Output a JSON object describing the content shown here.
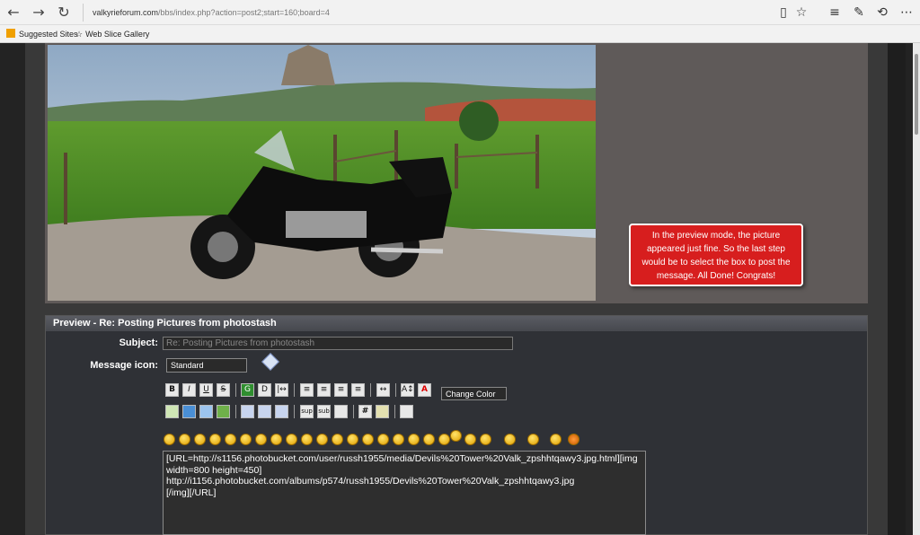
{
  "browser": {
    "url_domain": "valkyrieforum.com",
    "url_path": "/bbs/index.php?action=post2;start=160;board=4",
    "favorites": [
      {
        "label": "Suggested Sites"
      },
      {
        "label": "Web Slice Gallery"
      }
    ]
  },
  "post": {
    "callout_text": "In the preview mode, the picture appeared just fine. So the last step would be to select the box to post the message. All Done! Congrats!"
  },
  "preview": {
    "header": "Preview - Re: Posting Pictures from photostash",
    "subject_label": "Subject:",
    "subject_value": "Re: Posting Pictures from photostash",
    "message_icon_label": "Message icon:",
    "message_icon_value": "Standard",
    "change_color_label": "Change Color",
    "toolbar_row1": [
      "B",
      "I",
      "U",
      "S",
      "G",
      "D",
      "|↔",
      "≡",
      "≡",
      "≡",
      "≡",
      "↔",
      "A↕",
      "A"
    ],
    "toolbar_row2": [
      "img",
      "globe",
      "ftp",
      "flash",
      "tbl",
      "tr",
      "td",
      "sup",
      "sub",
      "tt",
      "#",
      "quote",
      "list"
    ],
    "message_body": "[URL=http://s1156.photobucket.com/user/russh1955/media/Devils%20Tower%20Valk_zpshhtqawy3.jpg.html][img width=800 height=450]\nhttp://i1156.photobucket.com/albums/p574/russh1955/Devils%20Tower%20Valk_zpshhtqawy3.jpg\n[/img][/URL]"
  }
}
